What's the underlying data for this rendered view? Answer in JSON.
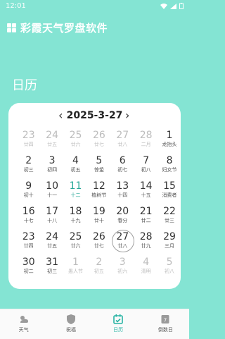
{
  "status_bar": {
    "time": "12:01"
  },
  "header": {
    "title": "彩霞天气罗盘软件"
  },
  "section": {
    "title": "日历"
  },
  "calendar": {
    "current_date": "2025-3-27",
    "prev_symbol": "‹",
    "next_symbol": "›",
    "rows": [
      [
        {
          "d": "23",
          "l": "廿四",
          "m": true
        },
        {
          "d": "24",
          "l": "廿五",
          "m": true
        },
        {
          "d": "25",
          "l": "廿六",
          "m": true
        },
        {
          "d": "26",
          "l": "廿七",
          "m": true
        },
        {
          "d": "27",
          "l": "廿八",
          "m": true
        },
        {
          "d": "28",
          "l": "二月",
          "m": true
        },
        {
          "d": "1",
          "l": "龙抬头"
        }
      ],
      [
        {
          "d": "2",
          "l": "初三"
        },
        {
          "d": "3",
          "l": "初四"
        },
        {
          "d": "4",
          "l": "初五"
        },
        {
          "d": "5",
          "l": "惊蛰"
        },
        {
          "d": "6",
          "l": "初七"
        },
        {
          "d": "7",
          "l": "初八"
        },
        {
          "d": "8",
          "l": "妇女节"
        }
      ],
      [
        {
          "d": "9",
          "l": "初十"
        },
        {
          "d": "10",
          "l": "十一"
        },
        {
          "d": "11",
          "l": "十二",
          "t": true
        },
        {
          "d": "12",
          "l": "植树节"
        },
        {
          "d": "13",
          "l": "十四"
        },
        {
          "d": "14",
          "l": "十五"
        },
        {
          "d": "15",
          "l": "消费者"
        }
      ],
      [
        {
          "d": "16",
          "l": "十七"
        },
        {
          "d": "17",
          "l": "十八"
        },
        {
          "d": "18",
          "l": "十九"
        },
        {
          "d": "19",
          "l": "廿十"
        },
        {
          "d": "20",
          "l": "春分"
        },
        {
          "d": "21",
          "l": "廿二"
        },
        {
          "d": "22",
          "l": "廿三"
        }
      ],
      [
        {
          "d": "23",
          "l": "廿四"
        },
        {
          "d": "24",
          "l": "廿五"
        },
        {
          "d": "25",
          "l": "廿六"
        },
        {
          "d": "26",
          "l": "廿七"
        },
        {
          "d": "27",
          "l": "廿八",
          "s": true
        },
        {
          "d": "28",
          "l": "廿九"
        },
        {
          "d": "29",
          "l": "三月"
        }
      ],
      [
        {
          "d": "30",
          "l": "初二"
        },
        {
          "d": "31",
          "l": "初三"
        },
        {
          "d": "1",
          "l": "愚人节",
          "m": true
        },
        {
          "d": "2",
          "l": "初五",
          "m": true
        },
        {
          "d": "3",
          "l": "初六",
          "m": true
        },
        {
          "d": "4",
          "l": "清明",
          "m": true
        },
        {
          "d": "5",
          "l": "初八",
          "m": true
        }
      ]
    ]
  },
  "bottom_nav": {
    "items": [
      {
        "label": "天气",
        "icon": "weather-icon",
        "active": false
      },
      {
        "label": "祝福",
        "icon": "shield-icon",
        "active": false
      },
      {
        "label": "日历",
        "icon": "calendar-icon",
        "active": true
      },
      {
        "label": "倒数日",
        "icon": "countdown-icon",
        "active": false
      }
    ]
  },
  "colors": {
    "background": "#84e4d3",
    "accent": "#26b3a3",
    "muted": "#bdbdbd"
  }
}
